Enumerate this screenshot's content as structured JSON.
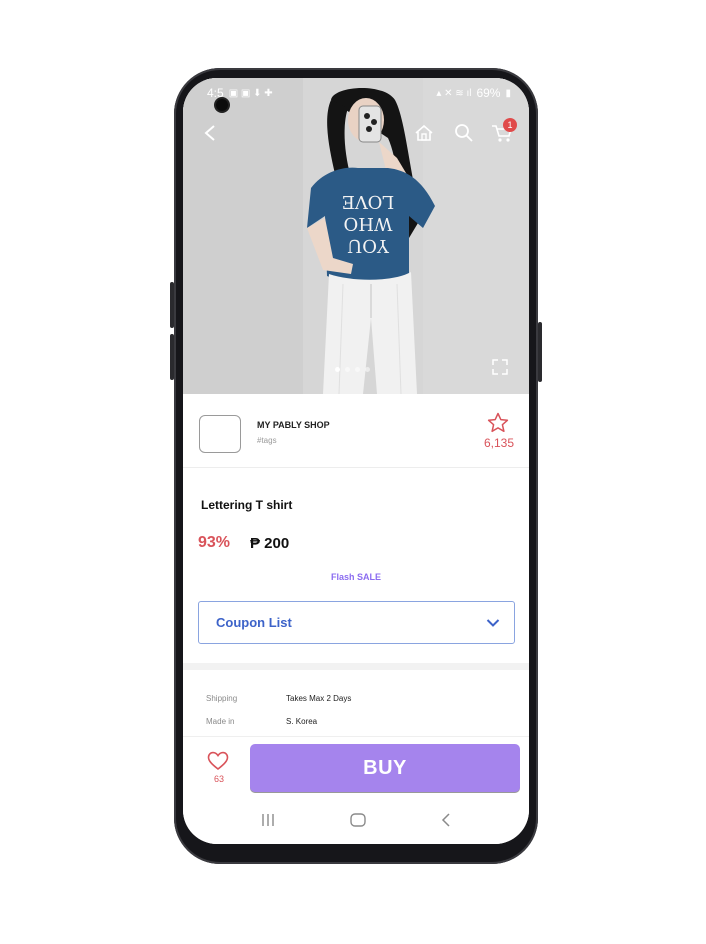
{
  "status_bar": {
    "time": "4:5",
    "battery": "69%"
  },
  "header": {
    "cart_count": "1"
  },
  "shop": {
    "name": "MY PABLY SHOP",
    "tags": "#tags",
    "favorite_count": "6,135"
  },
  "product": {
    "title": "Lettering T shirt",
    "discount": "93%",
    "price": "₱ 200",
    "flash_label": "Flash SALE",
    "shirt_print": [
      "LOVE",
      "WHO",
      "YOU"
    ]
  },
  "coupon": {
    "label": "Coupon List"
  },
  "specs": [
    {
      "label": "Shipping",
      "value": "Takes Max 2 Days"
    },
    {
      "label": "Made in",
      "value": "S. Korea"
    }
  ],
  "action_bar": {
    "like_count": "63",
    "buy_label": "BUY"
  },
  "colors": {
    "accent": "#a584ed",
    "price_red": "#d9535a",
    "link_blue": "#3d63c9"
  },
  "icons": [
    "back-icon",
    "home-icon",
    "search-icon",
    "cart-icon",
    "expand-icon",
    "star-icon",
    "chevron-down-icon",
    "heart-icon",
    "recents-icon",
    "home-nav-icon",
    "back-nav-icon"
  ]
}
